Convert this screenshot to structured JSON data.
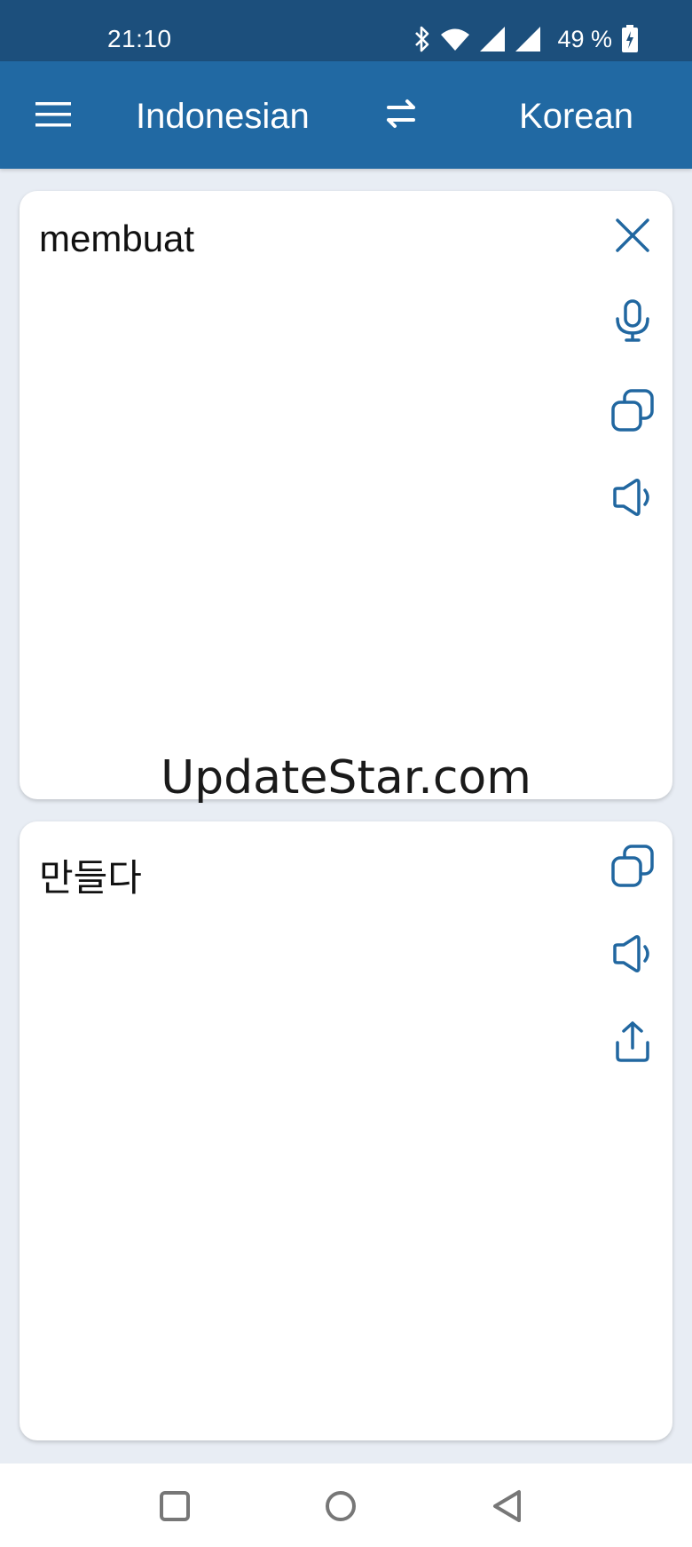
{
  "status_bar": {
    "time": "21:10",
    "battery": "49 %",
    "icons": [
      "bluetooth-icon",
      "wifi-icon",
      "signal-icon",
      "signal-icon",
      "battery-charging-icon"
    ]
  },
  "app_bar": {
    "source_language": "Indonesian",
    "target_language": "Korean",
    "icons": [
      "menu-icon",
      "swap-icon"
    ]
  },
  "source_card": {
    "text": "membuat",
    "icons": [
      "close-icon",
      "microphone-icon",
      "copy-icon",
      "speaker-icon"
    ]
  },
  "target_card": {
    "text": "만들다",
    "icons": [
      "copy-icon",
      "speaker-icon",
      "share-icon"
    ]
  },
  "watermark": "UpdateStar.com",
  "nav_bar": {
    "icons": [
      "recents-icon",
      "home-icon",
      "back-icon"
    ]
  },
  "colors": {
    "status_bar": "#1c4f7c",
    "app_bar": "#2169a3",
    "accent": "#2167a0",
    "background": "#e8edf4"
  }
}
